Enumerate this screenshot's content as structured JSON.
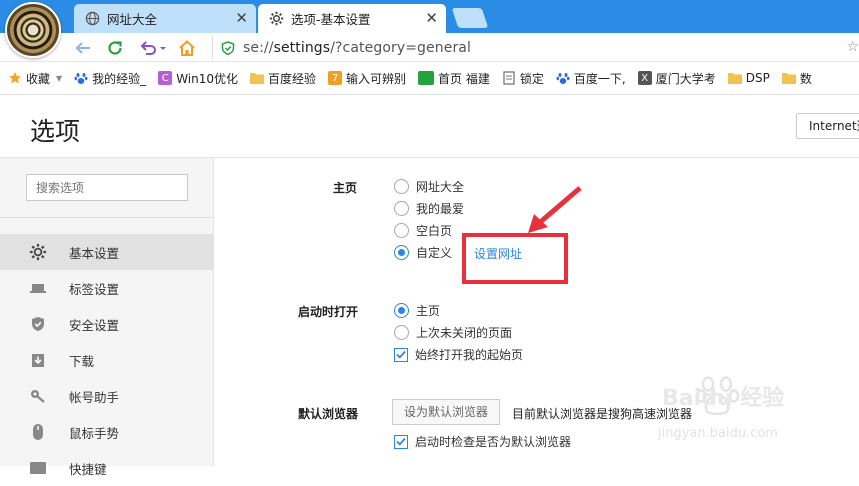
{
  "tabs": [
    {
      "label": "网址大全",
      "icon": "globe-icon"
    },
    {
      "label": "选项-基本设置",
      "icon": "gear-icon"
    }
  ],
  "addressbar": {
    "url_prefix": "se://",
    "url_host": "settings",
    "url_rest": "/?category=general"
  },
  "bookmarks": [
    {
      "label": "收藏",
      "icon": "star-icon",
      "color": "#f5a623"
    },
    {
      "label": "我的经验_",
      "icon": "baidu-paw-icon",
      "color": "#2a6de0"
    },
    {
      "label": "Win10优化",
      "icon": "c-letter-icon",
      "glyph": "C",
      "color": "#b45fd6"
    },
    {
      "label": "百度经验",
      "icon": "folder-icon",
      "color": "#f2c14e"
    },
    {
      "label": "输入可辨别",
      "icon": "seven-icon",
      "glyph": "7",
      "color": "#f0a020"
    },
    {
      "label": "首页 福建",
      "icon": "green-logo-icon",
      "glyph": "",
      "color": "#25a33b"
    },
    {
      "label": "锁定",
      "icon": "page-icon",
      "color": "#777"
    },
    {
      "label": "百度一下,",
      "icon": "baidu-paw-icon",
      "color": "#2a6de0"
    },
    {
      "label": "厦门大学考",
      "icon": "x-letter-icon",
      "glyph": "X",
      "color": "#555"
    },
    {
      "label": "DSP",
      "icon": "folder-icon",
      "color": "#f2c14e"
    },
    {
      "label": "数",
      "icon": "folder-icon",
      "color": "#f2c14e"
    }
  ],
  "page": {
    "title": "选项",
    "ie_button": "Internet选"
  },
  "sidebar": {
    "search_placeholder": "搜索选项",
    "items": [
      {
        "label": "基本设置",
        "icon": "gear-icon",
        "selected": true
      },
      {
        "label": "标签设置",
        "icon": "tab-icon",
        "selected": false
      },
      {
        "label": "安全设置",
        "icon": "shield-check-icon",
        "selected": false
      },
      {
        "label": "下载",
        "icon": "download-icon",
        "selected": false
      },
      {
        "label": "帐号助手",
        "icon": "key-icon",
        "selected": false
      },
      {
        "label": "鼠标手势",
        "icon": "mouse-icon",
        "selected": false
      },
      {
        "label": "快捷键",
        "icon": "keyboard-icon",
        "selected": false
      }
    ]
  },
  "homepage": {
    "label": "主页",
    "options": [
      {
        "label": "网址大全",
        "checked": false
      },
      {
        "label": "我的最爱",
        "checked": false
      },
      {
        "label": "空白页",
        "checked": false
      },
      {
        "label": "自定义",
        "checked": true
      }
    ],
    "set_url_link": "设置网址"
  },
  "startup": {
    "label": "启动时打开",
    "options": [
      {
        "label": "主页",
        "checked": true
      },
      {
        "label": "上次未关闭的页面",
        "checked": false
      }
    ],
    "always_open_start": {
      "label": "始终打开我的起始页",
      "checked": true
    }
  },
  "default_browser": {
    "label": "默认浏览器",
    "button": "设为默认浏览器",
    "status": "目前默认浏览器是搜狗高速浏览器",
    "check_on_start": {
      "label": "启动时检查是否为默认浏览器",
      "checked": true
    }
  },
  "watermark": {
    "text": "Baidu 经验",
    "sub": "jingyan.baidu.com"
  },
  "colors": {
    "accent": "#2a86e0",
    "tabbar": "#2b8ce6",
    "annotation": "#e8313b"
  }
}
